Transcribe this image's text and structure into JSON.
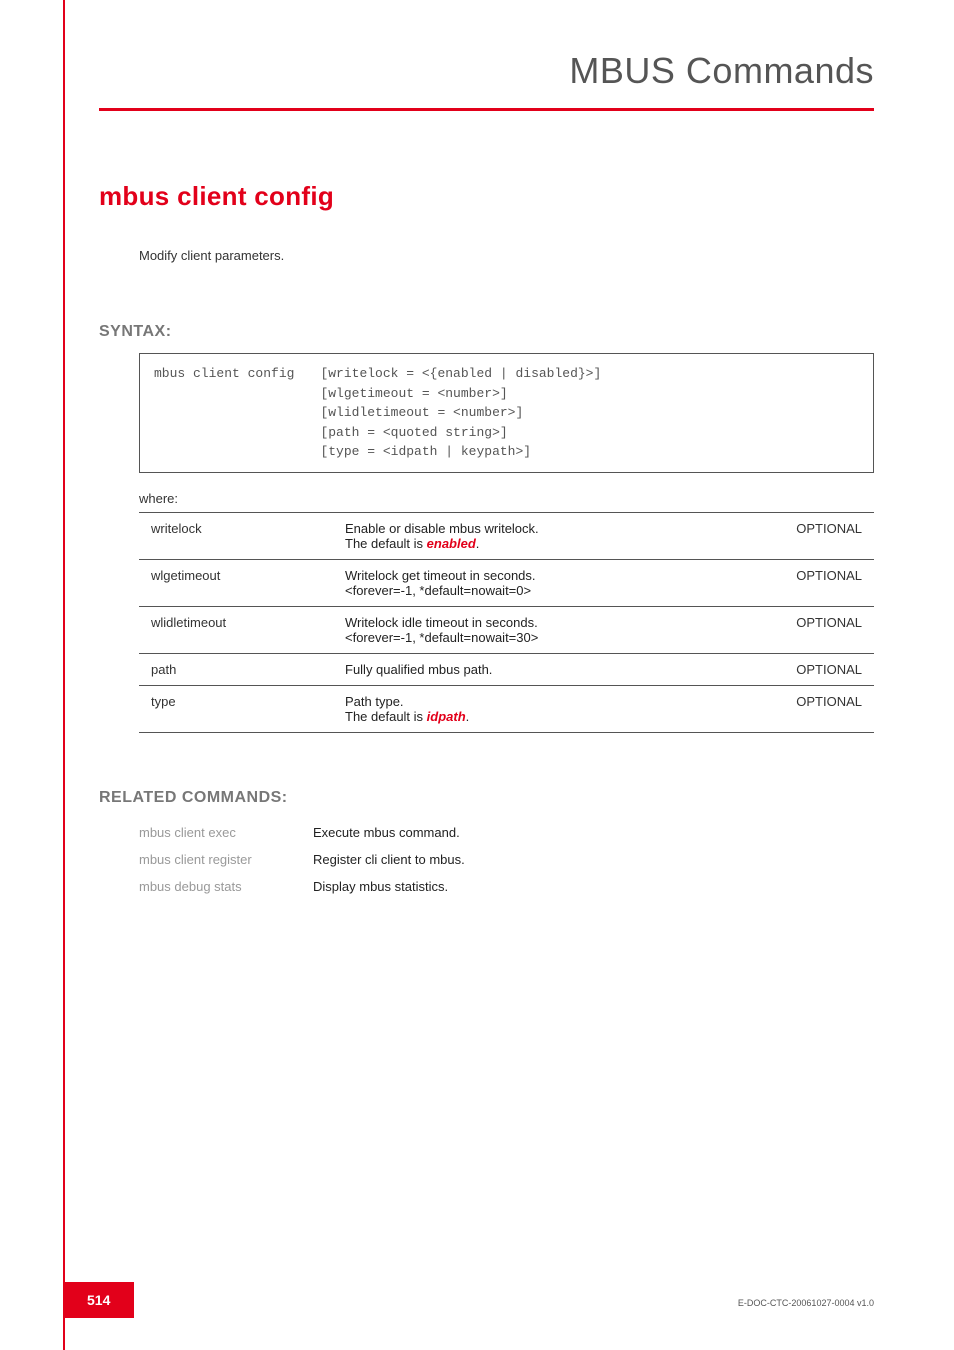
{
  "header": {
    "title": "MBUS Commands"
  },
  "command": {
    "title": "mbus client config",
    "intro": "Modify client parameters."
  },
  "syntax": {
    "label": "SYNTAX:",
    "cmd": "mbus client config",
    "args": "[writelock = <{enabled | disabled}>]\n[wlgetimeout = <number>]\n[wlidletimeout = <number>]\n[path = <quoted string>]\n[type = <idpath | keypath>]",
    "where_label": "where:"
  },
  "params": [
    {
      "name": "writelock",
      "desc_pre": "Enable or disable mbus writelock.\nThe default is ",
      "emph": "enabled",
      "desc_post": ".",
      "req": "OPTIONAL"
    },
    {
      "name": "wlgetimeout",
      "desc_pre": "Writelock get timeout in seconds.\n<forever=-1, *default=nowait=0>",
      "emph": "",
      "desc_post": "",
      "req": "OPTIONAL"
    },
    {
      "name": "wlidletimeout",
      "desc_pre": "Writelock idle timeout in seconds.\n<forever=-1, *default=nowait=30>",
      "emph": "",
      "desc_post": "",
      "req": "OPTIONAL"
    },
    {
      "name": "path",
      "desc_pre": "Fully qualified mbus path.",
      "emph": "",
      "desc_post": "",
      "req": "OPTIONAL"
    },
    {
      "name": "type",
      "desc_pre": "Path type.\nThe default is ",
      "emph": "idpath",
      "desc_post": ".",
      "req": "OPTIONAL"
    }
  ],
  "related": {
    "label": "RELATED COMMANDS:",
    "rows": [
      {
        "link": "mbus client exec",
        "desc": "Execute mbus command."
      },
      {
        "link": "mbus client register",
        "desc": "Register cli client to mbus."
      },
      {
        "link": "mbus debug stats",
        "desc": "Display mbus statistics."
      }
    ]
  },
  "footer": {
    "page": "514",
    "docid": "E-DOC-CTC-20061027-0004 v1.0"
  }
}
